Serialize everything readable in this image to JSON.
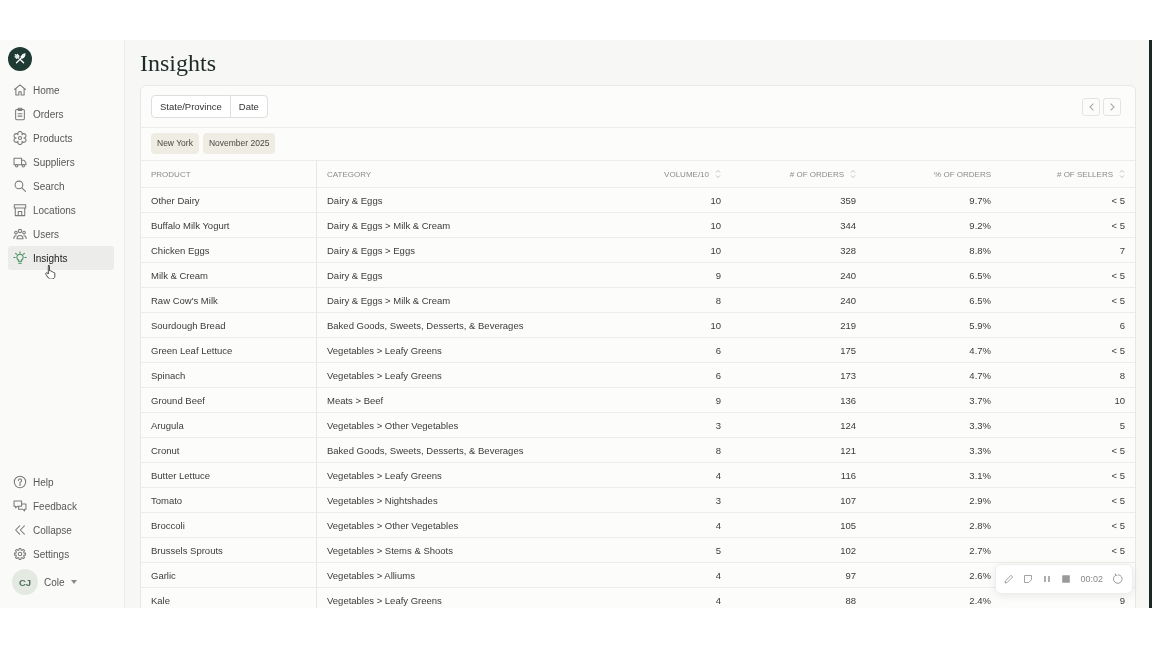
{
  "sidebar": {
    "nav": [
      {
        "label": "Home",
        "selected": false
      },
      {
        "label": "Orders",
        "selected": false
      },
      {
        "label": "Products",
        "selected": false
      },
      {
        "label": "Suppliers",
        "selected": false
      },
      {
        "label": "Search",
        "selected": false
      },
      {
        "label": "Locations",
        "selected": false
      },
      {
        "label": "Users",
        "selected": false
      },
      {
        "label": "Insights",
        "selected": true
      }
    ],
    "footer_items": [
      {
        "label": "Help"
      },
      {
        "label": "Feedback"
      },
      {
        "label": "Collapse"
      },
      {
        "label": "Settings"
      }
    ],
    "user": {
      "initials": "CJ",
      "name": "Cole"
    }
  },
  "page": {
    "title": "Insights"
  },
  "filters": {
    "tabs": [
      {
        "label": "State/Province",
        "selected": false
      },
      {
        "label": "Date",
        "selected": false
      }
    ],
    "chips": [
      "New York",
      "November 2025"
    ]
  },
  "table": {
    "columns": [
      {
        "label": "PRODUCT",
        "kind": "text",
        "sortable": false
      },
      {
        "label": "CATEGORY",
        "kind": "text",
        "sortable": false
      },
      {
        "label": "VOLUME/10",
        "kind": "number",
        "sortable": true
      },
      {
        "label": "# OF ORDERS",
        "kind": "number",
        "sortable": true
      },
      {
        "label": "% OF ORDERS",
        "kind": "number",
        "sortable": false
      },
      {
        "label": "# OF SELLERS",
        "kind": "number",
        "sortable": true
      }
    ],
    "rows": [
      [
        "Other Dairy",
        "Dairy & Eggs",
        "10",
        "359",
        "9.7%",
        "< 5"
      ],
      [
        "Buffalo Milk Yogurt",
        "Dairy & Eggs > Milk & Cream",
        "10",
        "344",
        "9.2%",
        "< 5"
      ],
      [
        "Chicken Eggs",
        "Dairy & Eggs > Eggs",
        "10",
        "328",
        "8.8%",
        "7"
      ],
      [
        "Milk & Cream",
        "Dairy & Eggs",
        "9",
        "240",
        "6.5%",
        "< 5"
      ],
      [
        "Raw Cow's Milk",
        "Dairy & Eggs > Milk & Cream",
        "8",
        "240",
        "6.5%",
        "< 5"
      ],
      [
        "Sourdough Bread",
        "Baked Goods, Sweets, Desserts, & Beverages",
        "10",
        "219",
        "5.9%",
        "6"
      ],
      [
        "Green Leaf Lettuce",
        "Vegetables > Leafy Greens",
        "6",
        "175",
        "4.7%",
        "< 5"
      ],
      [
        "Spinach",
        "Vegetables > Leafy Greens",
        "6",
        "173",
        "4.7%",
        "8"
      ],
      [
        "Ground Beef",
        "Meats > Beef",
        "9",
        "136",
        "3.7%",
        "10"
      ],
      [
        "Arugula",
        "Vegetables > Other Vegetables",
        "3",
        "124",
        "3.3%",
        "5"
      ],
      [
        "Cronut",
        "Baked Goods, Sweets, Desserts, & Beverages",
        "8",
        "121",
        "3.3%",
        "< 5"
      ],
      [
        "Butter Lettuce",
        "Vegetables > Leafy Greens",
        "4",
        "116",
        "3.1%",
        "< 5"
      ],
      [
        "Tomato",
        "Vegetables > Nightshades",
        "3",
        "107",
        "2.9%",
        "< 5"
      ],
      [
        "Broccoli",
        "Vegetables > Other Vegetables",
        "4",
        "105",
        "2.8%",
        "< 5"
      ],
      [
        "Brussels Sprouts",
        "Vegetables > Stems & Shoots",
        "5",
        "102",
        "2.7%",
        "< 5"
      ],
      [
        "Garlic",
        "Vegetables > Alliums",
        "4",
        "97",
        "2.6%"
      ],
      [
        "Kale",
        "Vegetables > Leafy Greens",
        "4",
        "88",
        "2.4%",
        "9"
      ]
    ]
  },
  "recorder": {
    "time": "00:02"
  }
}
